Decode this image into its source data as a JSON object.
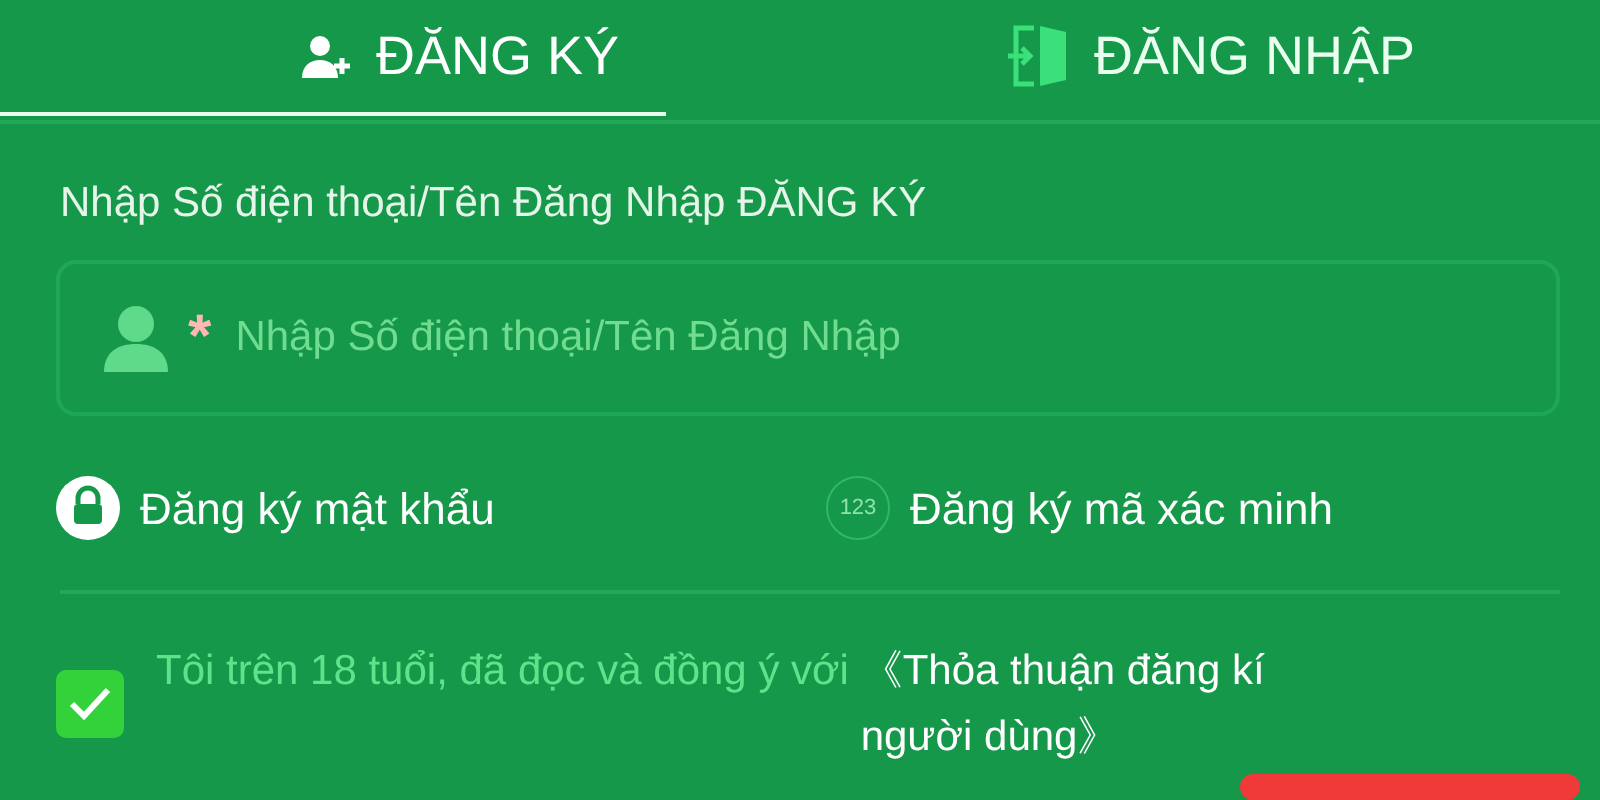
{
  "tabs": [
    {
      "label": "ĐĂNG KÝ",
      "kind": "register",
      "selected": true
    },
    {
      "label": "ĐĂNG NHẬP",
      "kind": "login",
      "selected": false
    }
  ],
  "field_label": "Nhập Số điện thoại/Tên Đăng Nhập ĐĂNG KÝ",
  "username_field": {
    "required_mark": "*",
    "placeholder": "Nhập Số điện thoại/Tên Đăng Nhập"
  },
  "methods": [
    {
      "label": "Đăng ký mật khẩu",
      "kind": "password"
    },
    {
      "label": "Đăng ký mã xác minh",
      "kind": "code",
      "icon_text": "123"
    }
  ],
  "agreement": {
    "checked": true,
    "text": "Tôi trên 18 tuổi, đã đọc và đồng ý với",
    "link": "《Thỏa thuận đăng kí người dùng》"
  },
  "promo_badge": {
    "kind": "badge"
  }
}
